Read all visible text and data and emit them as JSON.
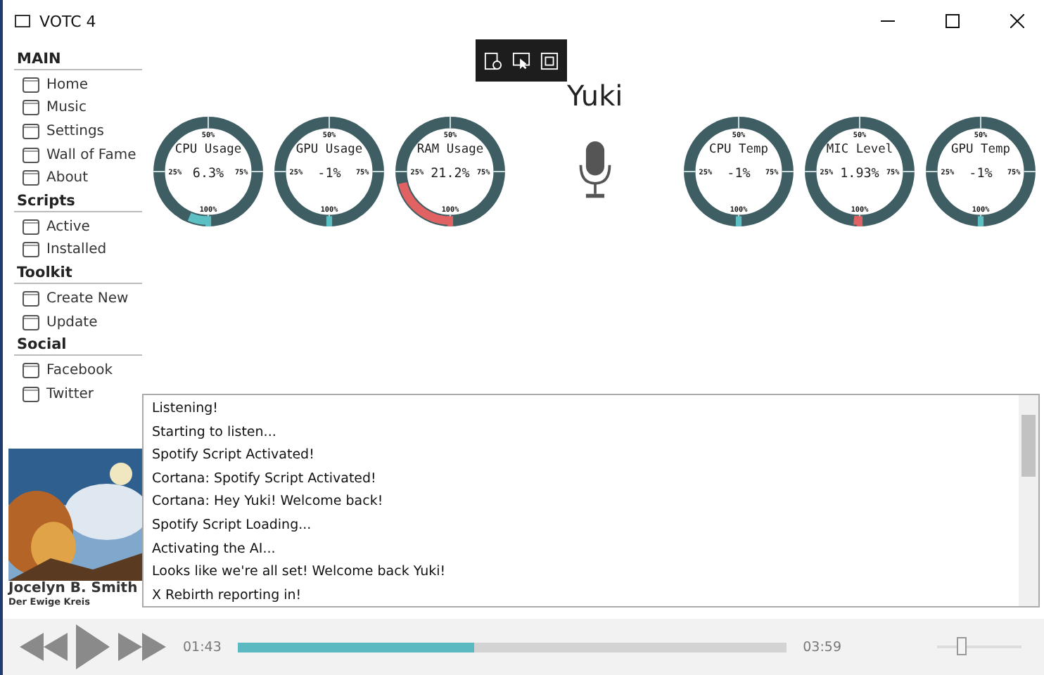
{
  "window": {
    "title": "VOTC 4"
  },
  "sidebar": [
    {
      "heading": "MAIN",
      "items": [
        "Home",
        "Music",
        "Settings",
        "Wall of Fame",
        "About"
      ]
    },
    {
      "heading": "Scripts",
      "items": [
        "Active",
        "Installed"
      ]
    },
    {
      "heading": "Toolkit",
      "items": [
        "Create New",
        "Update"
      ]
    },
    {
      "heading": "Social",
      "items": [
        "Facebook",
        "Twitter"
      ]
    }
  ],
  "assistant_name": "Yuki",
  "gauges": [
    {
      "title": "CPU Usage",
      "value": "6.3%",
      "level": 0.063,
      "color": "#5bbfc4",
      "ticks": [
        "50%",
        "25%",
        "75%",
        "100%"
      ]
    },
    {
      "title": "GPU Usage",
      "value": "-1%",
      "color": "#5bbfc4",
      "ticks": [
        "50%",
        "25%",
        "75%",
        "100%"
      ]
    },
    {
      "title": "RAM Usage",
      "value": "21.2%",
      "level": 0.212,
      "color": "#e06262",
      "ticks": [
        "50%",
        "25%",
        "75%",
        "100%"
      ]
    },
    {
      "title": "CPU Temp",
      "value": "-1%",
      "color": "#5bbfc4",
      "ticks": [
        "50%",
        "25%",
        "75%",
        "100%"
      ]
    },
    {
      "title": "MIC Level",
      "value": "1.93%",
      "level": 0.0193,
      "color": "#e06262",
      "ticks": [
        "50%",
        "25%",
        "75%",
        "100%"
      ]
    },
    {
      "title": "GPU Temp",
      "value": "-1%",
      "color": "#5bbfc4",
      "ticks": [
        "50%",
        "25%",
        "75%",
        "100%"
      ]
    }
  ],
  "log": [
    "Listening!",
    "Starting to listen...",
    "Spotify Script Activated!",
    "Cortana: Spotify Script Activated!",
    "Cortana: Hey Yuki! Welcome back!",
    "Spotify Script Loading...",
    "Activating the AI...",
    "Looks like we're all set! Welcome back Yuki!",
    "X Rebirth reporting in!"
  ],
  "now_playing": {
    "artist": "Jocelyn B. Smith",
    "title": "Der Ewige Kreis"
  },
  "player": {
    "elapsed": "01:43",
    "total": "03:59",
    "level": 0.43,
    "volume": {
      "level": 0.28
    }
  }
}
